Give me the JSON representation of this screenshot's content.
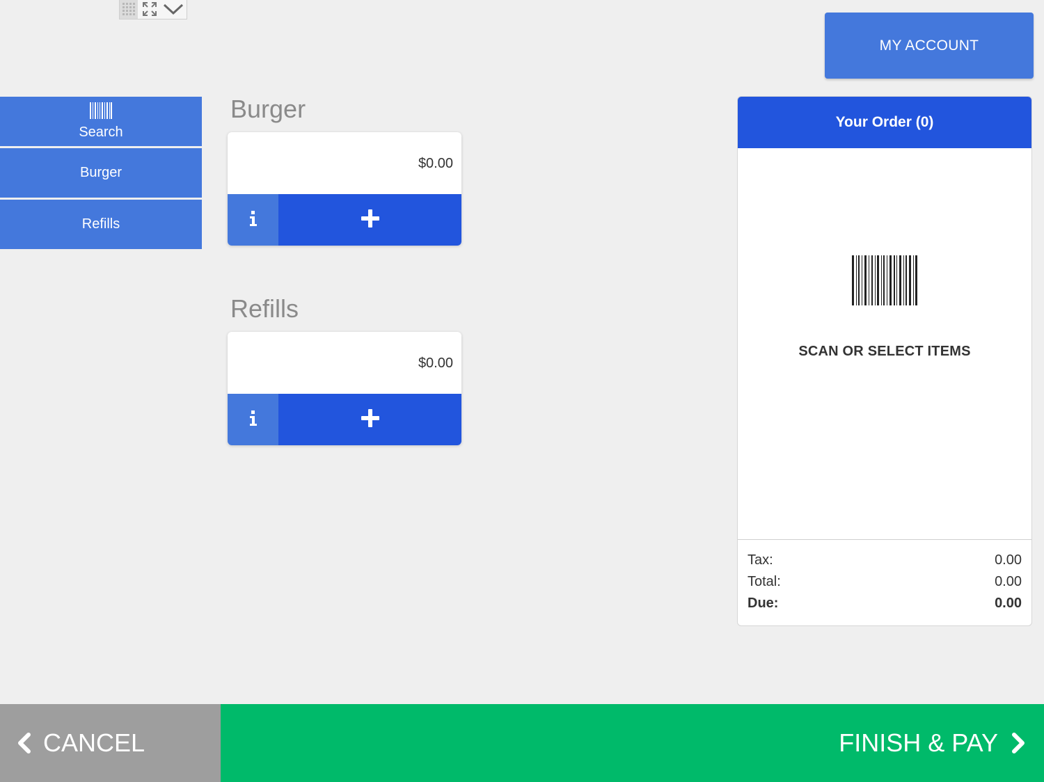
{
  "toolbar": {
    "icons": [
      "grid-icon",
      "expand-icon",
      "chevron-down-icon"
    ]
  },
  "header": {
    "my_account_label": "MY ACCOUNT"
  },
  "sidebar": {
    "items": [
      {
        "label": "Search",
        "icon": "barcode-icon"
      },
      {
        "label": "Burger"
      },
      {
        "label": "Refills"
      }
    ]
  },
  "categories": [
    {
      "title": "Burger",
      "products": [
        {
          "price": "$0.00"
        }
      ]
    },
    {
      "title": "Refills",
      "products": [
        {
          "price": "$0.00"
        }
      ]
    }
  ],
  "order": {
    "header": "Your Order (0)",
    "empty_message": "SCAN OR SELECT ITEMS",
    "totals": {
      "tax_label": "Tax:",
      "tax_value": "0.00",
      "total_label": "Total:",
      "total_value": "0.00",
      "due_label": "Due:",
      "due_value": "0.00"
    }
  },
  "footer": {
    "cancel_label": "CANCEL",
    "finish_label": "FINISH & PAY"
  },
  "colors": {
    "primary": "#4478dc",
    "primary_dark": "#2255dd",
    "success": "#00ba6a",
    "cancel": "#9e9e9e",
    "background": "#efefef"
  }
}
